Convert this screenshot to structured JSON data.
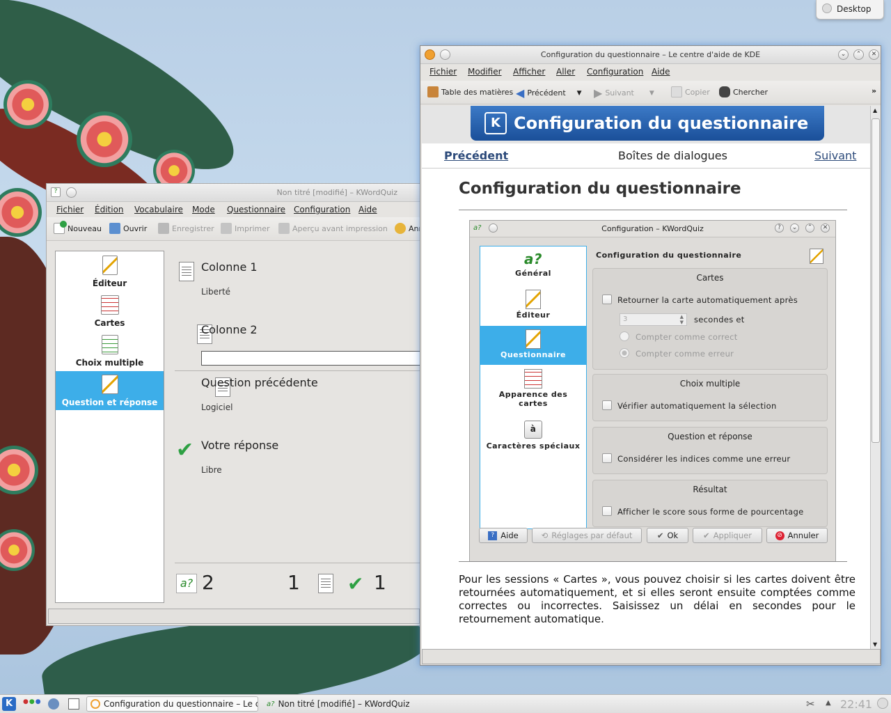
{
  "desktop": {
    "pill_label": "Desktop"
  },
  "kwq": {
    "title": "Non titré [modifié] – KWordQuiz",
    "menu": [
      "Fichier",
      "Édition",
      "Vocabulaire",
      "Mode",
      "Questionnaire",
      "Configuration",
      "Aide"
    ],
    "toolbar": {
      "new": "Nouveau",
      "open": "Ouvrir",
      "save": "Enregistrer",
      "print": "Imprimer",
      "preview": "Aperçu avant impression",
      "undo": "Ann"
    },
    "sidebar": [
      "Éditeur",
      "Cartes",
      "Choix multiple",
      "Question et réponse"
    ],
    "col1_title": "Colonne 1",
    "col1_value": "Liberté",
    "col2_title": "Colonne 2",
    "col2_input": "",
    "prev_title": "Question précédente",
    "prev_value": "Logiciel",
    "answer_title": "Votre réponse",
    "answer_value": "Libre",
    "score_questions": "2",
    "score_count": "1",
    "score_correct": "1"
  },
  "help": {
    "title": "Configuration du questionnaire – Le centre d'aide de KDE",
    "menu": [
      "Fichier",
      "Modifier",
      "Afficher",
      "Aller",
      "Configuration",
      "Aide"
    ],
    "toolbar": {
      "toc": "Table des matières",
      "back": "Précédent",
      "forward": "Suivant",
      "copy": "Copier",
      "find": "Chercher"
    },
    "banner": "Configuration du questionnaire",
    "nav_prev": "Précédent",
    "nav_center": "Boîtes de dialogues",
    "nav_next": "Suivant",
    "heading": "Configuration du questionnaire",
    "paragraph": "Pour les sessions « Cartes », vous pouvez choisir si les cartes doivent être retournées automatiquement, et si elles seront ensuite comptées comme correctes ou incorrectes. Saisissez un délai en secondes pour le retournement automatique."
  },
  "dialog": {
    "title": "Configuration – KWordQuiz",
    "pages": [
      "Général",
      "Éditeur",
      "Questionnaire",
      "Apparence des cartes",
      "Caractères spéciaux"
    ],
    "page_header": "Configuration du questionnaire",
    "group_cards": "Cartes",
    "flip_auto": "Retourner la carte automatiquement après",
    "spin_value": "3",
    "seconds": "secondes et",
    "count_correct": "Compter comme correct",
    "count_error": "Compter comme erreur",
    "group_mc": "Choix multiple",
    "mc_check": "Vérifier automatiquement la sélection",
    "group_qa": "Question et réponse",
    "qa_hints": "Considérer les indices comme une erreur",
    "group_result": "Résultat",
    "result_percent": "Afficher le score sous forme de pourcentage",
    "btn_help": "Aide",
    "btn_defaults": "Réglages par défaut",
    "btn_ok": "Ok",
    "btn_apply": "Appliquer",
    "btn_cancel": "Annuler"
  },
  "taskbar": {
    "task1": "Configuration du questionnaire – Le cen",
    "task2": "Non titré [modifié] – KWordQuiz",
    "clock": "22:41"
  }
}
